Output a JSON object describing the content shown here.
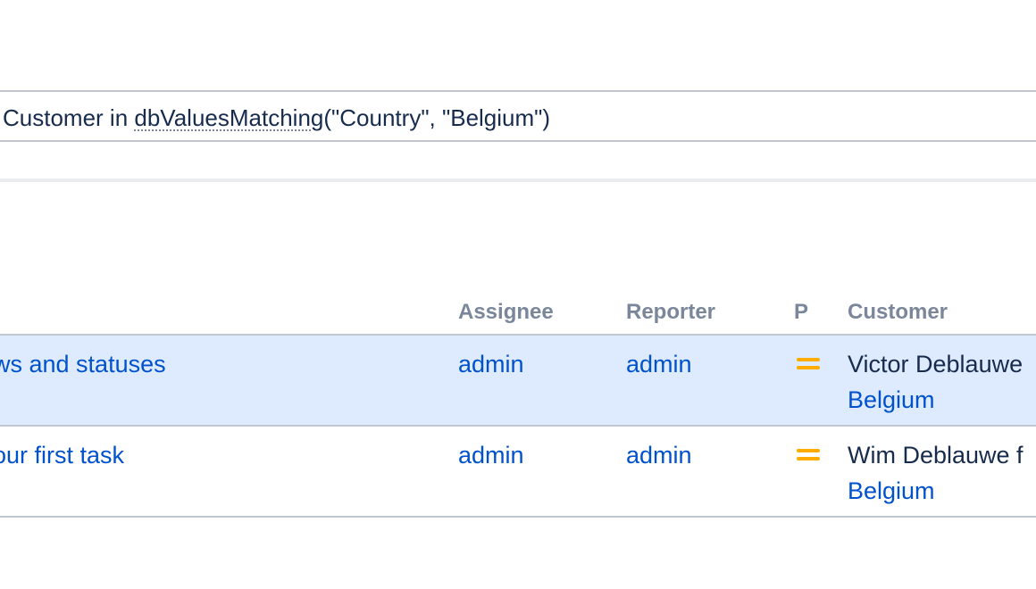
{
  "query": {
    "prefix": "Customer in ",
    "function": "dbValuesMatching",
    "args": "(\"Country\", \"Belgium\")"
  },
  "table": {
    "columns": {
      "assignee": "Assignee",
      "reporter": "Reporter",
      "priority": "P",
      "customer": "Customer"
    },
    "rows": [
      {
        "summary": "ws and statuses",
        "assignee": "admin",
        "reporter": "admin",
        "priority_icon": "priority-medium-icon",
        "customer_name": "Victor Deblauwe",
        "customer_country": "Belgium",
        "selected": true
      },
      {
        "summary": "our first task",
        "assignee": "admin",
        "reporter": "admin",
        "priority_icon": "priority-medium-icon",
        "customer_name": "Wim Deblauwe f",
        "customer_country": "Belgium",
        "selected": false
      }
    ]
  },
  "colors": {
    "link": "#0052cc",
    "selected_row": "#deebff",
    "priority_medium": "#ffab00",
    "header_text": "#7a869a"
  }
}
